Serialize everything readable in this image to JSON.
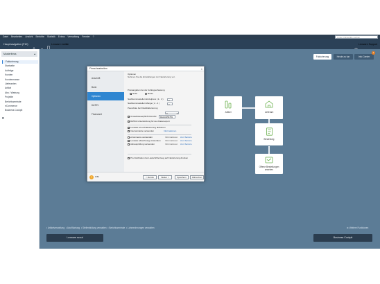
{
  "menu": [
    "Datei",
    "Bearbeiten",
    "Ansicht",
    "Berichte",
    "Statistik",
    "Extras",
    "Verwaltung",
    "Fenster",
    "?"
  ],
  "search_placeholder": "In der Onlinehilfe suchen",
  "toolbar": {
    "title": "Hauptnavigation (F10)",
    "lexware_mobile": "Lexware mobile",
    "support": "Lexware Support"
  },
  "sidebar": {
    "header": "Musterfirma",
    "items": [
      "Fakturierung",
      "Startseite",
      "Aufträge",
      "Kunden",
      "Kundenmasse",
      "Lieferanten",
      "Artikel",
      "Abo / Wartung",
      "Projekte",
      "Berichtszentrale",
      "eCommerce",
      "Business Cockpit"
    ]
  },
  "top_tabs": [
    "Fakturierung",
    "Heute zu tun",
    "Info Center"
  ],
  "badge": "1",
  "cards": {
    "artikel": "Artikel",
    "lieferant": "Lieferant",
    "bestellung": "Bestellung",
    "offene": "Offene Bestellungen",
    "offene2": "ansehen"
  },
  "bottom_links": [
    "Artikelverwaltung",
    "Abo/Wartung",
    "Stellenbildung verwalten",
    "Berichtszentrale",
    "Lohnrechnungen verwalten"
  ],
  "weitere": "Weitere Funktionen",
  "big_buttons": {
    "left": "Lexware scout",
    "right": "Business Cockpit"
  },
  "dialog": {
    "title": "Firma bearbeiten",
    "nav": [
      "Anschrift",
      "Bank",
      "Optionen",
      "DATEV",
      "Finanzamt"
    ],
    "heading": "Optionen",
    "subheading": "Nehmen Sie die Einstellungen zur Fakturierung vor.",
    "preisangaben": "Preisangaben bei der Auftragserfassung",
    "netto": "Netto",
    "brutto": "Brutto",
    "nk_einzelpreis": "Nachkommastellen Einzelpreis ( 2 - 4 )",
    "nk_einzelpreis_val": "2",
    "nk_menge": "Nachkommastellen Menge ( 2 - 4 )",
    "nk_menge_val": "2",
    "pauschale": "Pauschale bei Direktfakturierung",
    "pauschale_val": "0",
    "umsatz_label": "Umsatzsteuerpflicht:",
    "umsatz_val": "Ust-Idnr.",
    "umsatz_id": "DE123456789",
    "datev": "DATEV-Unterstützung für den Datenexport",
    "lexware_scout": "Lexware scout Fakturierung aktivieren",
    "internet": "Internetmarke verwenden",
    "internet_link": "Informationen",
    "ecommerce": "eCommerce verwenden",
    "info": "Informationen",
    "zum_service": "zum Service",
    "lexware_abrechnung": "Lexware abrechnung verwenden",
    "adresspruefung": "Adressprüfung verwenden",
    "pro_notification": "Pro-Notification bei Lastschrifterzeug auf Fakturierung drucken",
    "help": "Hilfe",
    "buttons": [
      "< Zurück",
      "Weiter >",
      "Speichern",
      "Abbrechen"
    ]
  },
  "colors": {
    "main_bg": "#5c7c96",
    "accent": "#2f86d1",
    "toolbar": "#2b4157",
    "card_icon": "#6ab04c",
    "badge": "#e67e22"
  }
}
